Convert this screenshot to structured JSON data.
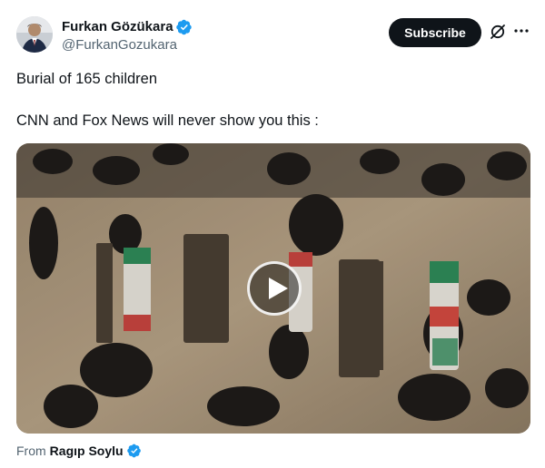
{
  "author": {
    "display_name": "Furkan Gözükara",
    "handle": "@FurkanGozukara",
    "verified": true
  },
  "header": {
    "subscribe_label": "Subscribe",
    "icons": [
      "grok-icon",
      "more-icon"
    ]
  },
  "tweet": {
    "line1": "Burial of 165 children",
    "line2": "CNN and Fox News will never show you this :"
  },
  "media": {
    "type": "video",
    "icon": "play-icon"
  },
  "source": {
    "prefix": "From",
    "name": "Ragıp Soylu",
    "verified": true
  },
  "colors": {
    "text": "#0f1419",
    "secondary": "#536471",
    "verified_blue": "#1d9bf0",
    "button_bg": "#0f1419",
    "button_text": "#ffffff"
  }
}
